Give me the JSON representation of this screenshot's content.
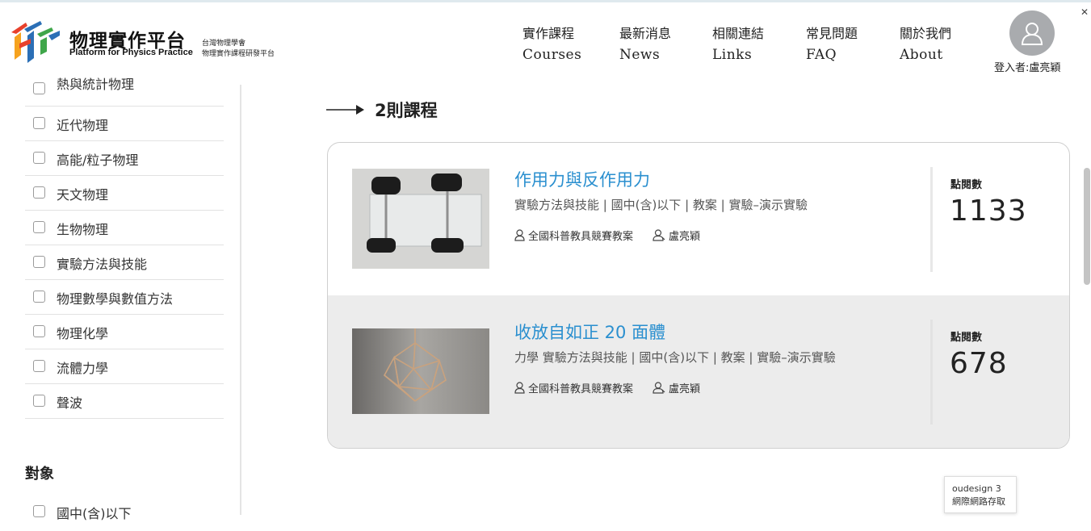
{
  "site": {
    "title": "物理實作平台",
    "subtitle": "Platform for Physics Practice",
    "org_line1": "台灣物理學會",
    "org_line2": "物理實作課程研發平台"
  },
  "nav": [
    {
      "zh": "實作課程",
      "en": "Courses"
    },
    {
      "zh": "最新消息",
      "en": "News"
    },
    {
      "zh": "相關連結",
      "en": "Links"
    },
    {
      "zh": "常見問題",
      "en": "FAQ"
    },
    {
      "zh": "關於我們",
      "en": "About"
    }
  ],
  "user": {
    "login_label": "登入者:盧亮穎",
    "icon": "user-icon"
  },
  "sidebar": {
    "filters": [
      {
        "label": "熱與統計物理"
      },
      {
        "label": "近代物理"
      },
      {
        "label": "高能/粒子物理"
      },
      {
        "label": "天文物理"
      },
      {
        "label": "生物物理"
      },
      {
        "label": "實驗方法與技能"
      },
      {
        "label": "物理數學與數值方法"
      },
      {
        "label": "物理化學"
      },
      {
        "label": "流體力學"
      },
      {
        "label": "聲波"
      }
    ],
    "audience_title": "對象",
    "audience_items": [
      {
        "label": "國中(含)以下"
      }
    ]
  },
  "results": {
    "count_label": "2則課程",
    "courses": [
      {
        "title": "作用力與反作用力",
        "tags": "實驗方法與技能 | 國中(含)以下 | 教案 | 實驗–演示實驗",
        "source": "全國科普教具競賽教案",
        "author": "盧亮穎",
        "views_label": "點閱數",
        "views": "1133"
      },
      {
        "title": "收放自如正 20 面體",
        "tags": "力學 實驗方法與技能 | 國中(含)以下 | 教案 | 實驗–演示實驗",
        "source": "全國科普教具競賽教案",
        "author": "盧亮穎",
        "views_label": "點閱數",
        "views": "678"
      }
    ]
  },
  "tooltip": {
    "line1": "oudesign 3",
    "line2": "網際網路存取"
  },
  "colors": {
    "accent": "#2a8fcf",
    "row_alt": "#ececec",
    "avatar": "#a9abae"
  }
}
